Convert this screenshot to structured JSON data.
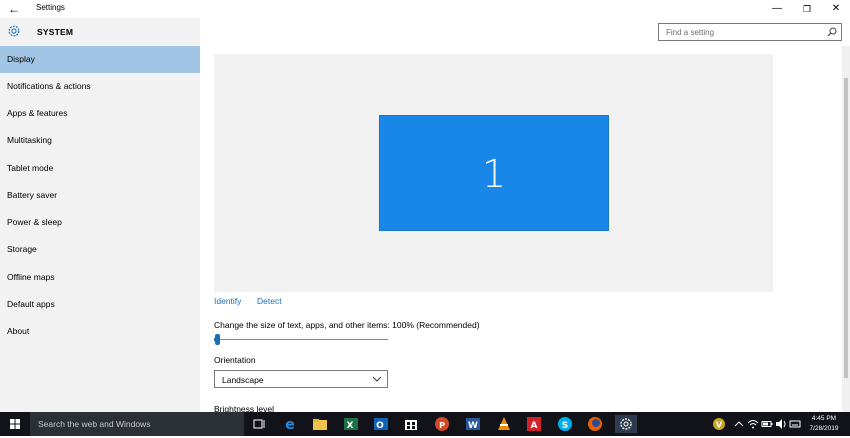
{
  "window": {
    "title": "Settings",
    "back_glyph": "←",
    "minimize_glyph": "—",
    "maximize_glyph": "❐",
    "close_glyph": "✕"
  },
  "sidebar": {
    "header": "SYSTEM",
    "items": [
      {
        "label": "Display"
      },
      {
        "label": "Notifications & actions"
      },
      {
        "label": "Apps & features"
      },
      {
        "label": "Multitasking"
      },
      {
        "label": "Tablet mode"
      },
      {
        "label": "Battery saver"
      },
      {
        "label": "Power & sleep"
      },
      {
        "label": "Storage"
      },
      {
        "label": "Offline maps"
      },
      {
        "label": "Default apps"
      },
      {
        "label": "About"
      }
    ],
    "selected": "Display"
  },
  "search": {
    "placeholder": "Find a setting"
  },
  "display": {
    "monitor_number": "1",
    "identify_label": "Identify",
    "detect_label": "Detect",
    "scale_label": "Change the size of text, apps, and other items: 100% (Recommended)",
    "scale_slider_value": 0,
    "orientation_label": "Orientation",
    "orientation_value": "Landscape",
    "brightness_label": "Brightness level"
  },
  "taskbar": {
    "search_text": "Search the web and Windows",
    "time": "4:45 PM",
    "date": "7/28/2019",
    "apps": [
      "task-view-icon",
      "edge-icon",
      "file-explorer-icon",
      "excel-icon",
      "outlook-icon",
      "store-icon",
      "powerpoint-icon",
      "word-icon",
      "vlc-icon",
      "acrobat-icon",
      "skype-icon",
      "firefox-icon",
      "settings-icon"
    ]
  },
  "colors": {
    "accent": "#1a6fb5",
    "selected_nav": "#a2c5e6",
    "monitor": "#1987e7"
  }
}
